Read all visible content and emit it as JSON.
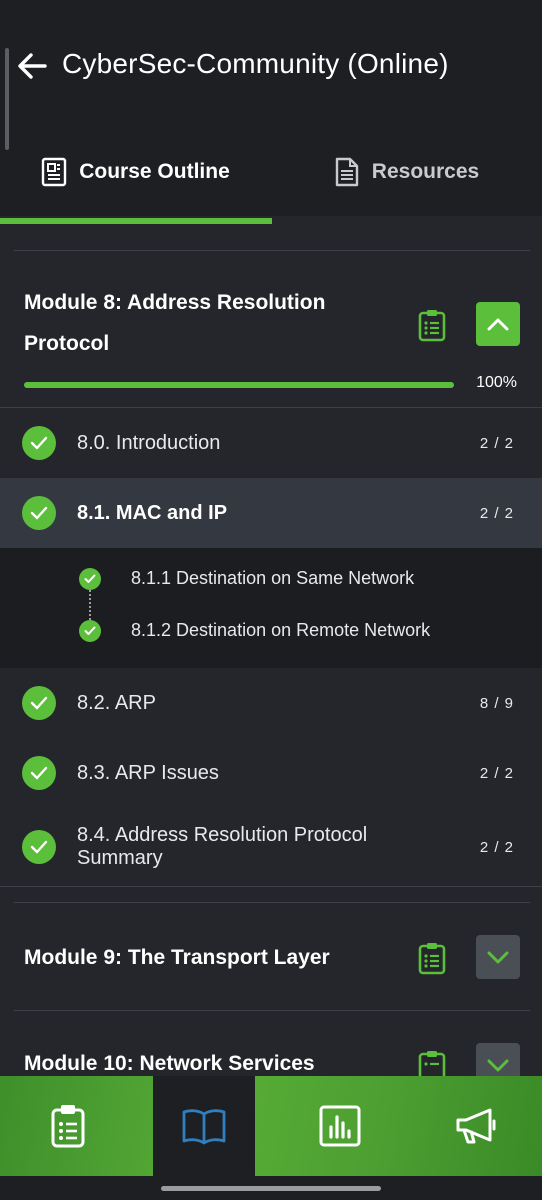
{
  "header": {
    "title": "CyberSec-Community (Online)"
  },
  "tabs": [
    {
      "label": "Course Outline",
      "active": true
    },
    {
      "label": "Resources",
      "active": false
    }
  ],
  "colors": {
    "accent": "#5bbf3b",
    "background": "#24262b",
    "header": "#1d1f22"
  },
  "modules": [
    {
      "title_line1": "Module 8: Address Resolution",
      "title_line2": "Protocol",
      "progress_percent": 100,
      "progress_text": "100%",
      "expanded": true,
      "lessons": [
        {
          "label": "8.0. Introduction",
          "count": "2 / 2"
        },
        {
          "label": "8.1. MAC and IP",
          "count": "2 / 2",
          "active": true,
          "topics": [
            {
              "label": "8.1.1 Destination on Same Network"
            },
            {
              "label": "8.1.2 Destination on Remote Network"
            }
          ]
        },
        {
          "label": "8.2. ARP",
          "count": "8 / 9"
        },
        {
          "label": "8.3. ARP Issues",
          "count": "2 / 2"
        },
        {
          "label_line1": "8.4. Address Resolution Protocol",
          "label_line2": "Summary",
          "count": "2 / 2"
        }
      ]
    },
    {
      "title": "Module 9: The Transport Layer",
      "expanded": false
    },
    {
      "title": "Module 10: Network Services",
      "expanded": false
    }
  ],
  "bottom_nav": [
    {
      "icon": "clipboard-list-icon",
      "active": false
    },
    {
      "icon": "open-book-icon",
      "active": true
    },
    {
      "icon": "bar-chart-icon",
      "active": false
    },
    {
      "icon": "megaphone-icon",
      "active": false
    }
  ]
}
